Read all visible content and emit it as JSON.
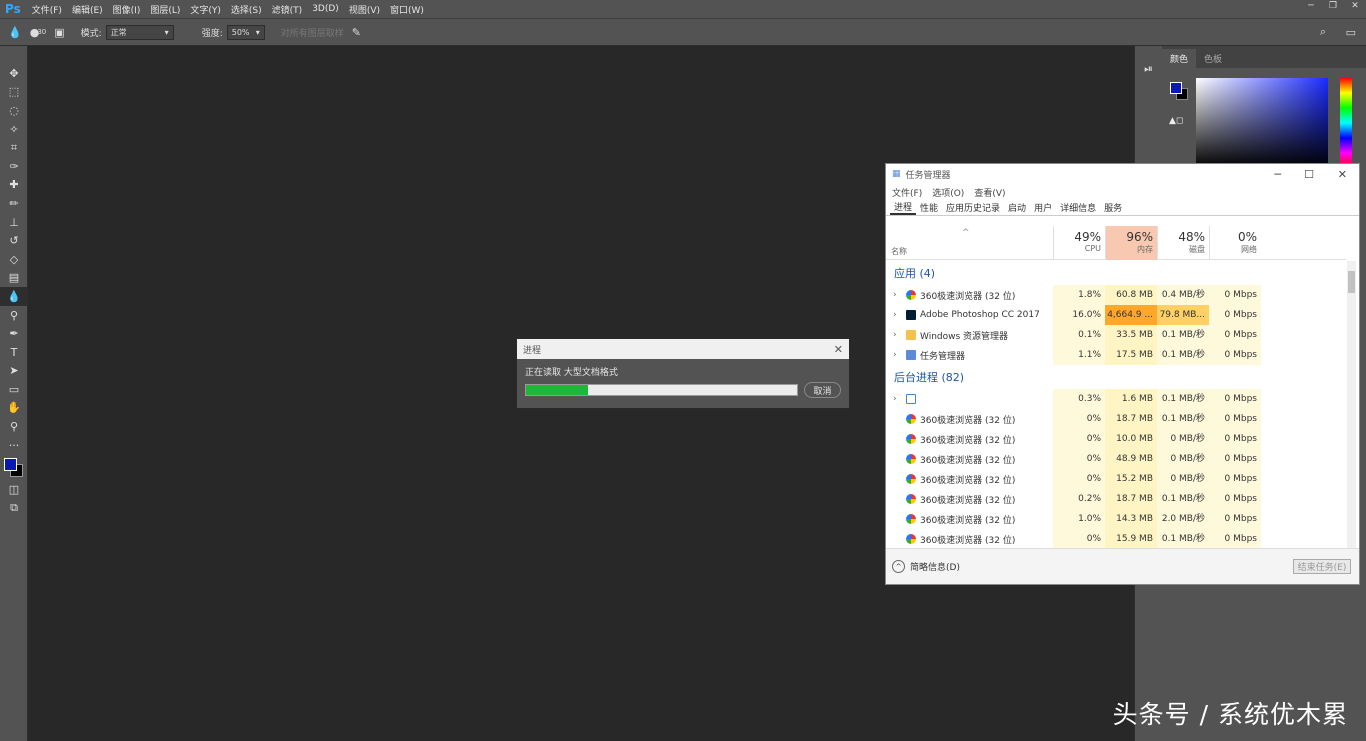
{
  "menubar": {
    "logo": "Ps",
    "items": [
      "文件(F)",
      "编辑(E)",
      "图像(I)",
      "图层(L)",
      "文字(Y)",
      "选择(S)",
      "滤镜(T)",
      "3D(D)",
      "视图(V)",
      "窗口(W)"
    ]
  },
  "options": {
    "brush_size": "30",
    "mode_label": "模式:",
    "mode_value": "正常",
    "strength_label": "强度:",
    "strength_value": "50%",
    "sample_all": "对所有图层取样"
  },
  "right_panel": {
    "tabs": [
      "颜色",
      "色板"
    ],
    "fg_color": "#0a19b4",
    "bg_color": "#000000"
  },
  "ps_dialog": {
    "title": "进程",
    "message": "正在读取 大型文档格式",
    "progress": 0.23,
    "cancel": "取消"
  },
  "task_manager": {
    "title": "任务管理器",
    "menu": [
      "文件(F)",
      "选项(O)",
      "查看(V)"
    ],
    "tabs": [
      "进程",
      "性能",
      "应用历史记录",
      "启动",
      "用户",
      "详细信息",
      "服务"
    ],
    "name_header": "名称",
    "columns": [
      {
        "pct": "49%",
        "label": "CPU"
      },
      {
        "pct": "96%",
        "label": "内存"
      },
      {
        "pct": "48%",
        "label": "磁盘"
      },
      {
        "pct": "0%",
        "label": "网络"
      }
    ],
    "apps_group": "应用 (4)",
    "apps": [
      {
        "name": "360极速浏览器 (32 位)",
        "cpu": "1.8%",
        "mem": "60.8 MB",
        "disk": "0.4 MB/秒",
        "net": "0 Mbps",
        "icon": "browser-icon"
      },
      {
        "name": "Adobe Photoshop CC 2017",
        "cpu": "16.0%",
        "mem": "4,664.9 ...",
        "disk": "79.8 MB...",
        "net": "0 Mbps",
        "icon": "photoshop-icon"
      },
      {
        "name": "Windows 资源管理器",
        "cpu": "0.1%",
        "mem": "33.5 MB",
        "disk": "0.1 MB/秒",
        "net": "0 Mbps",
        "icon": "folder-icon"
      },
      {
        "name": "任务管理器",
        "cpu": "1.1%",
        "mem": "17.5 MB",
        "disk": "0.1 MB/秒",
        "net": "0 Mbps",
        "icon": "taskmgr-icon"
      }
    ],
    "bg_group": "后台进程 (82)",
    "bg": [
      {
        "name": "",
        "cpu": "0.3%",
        "mem": "1.6 MB",
        "disk": "0.1 MB/秒",
        "net": "0 Mbps"
      },
      {
        "name": "360极速浏览器 (32 位)",
        "cpu": "0%",
        "mem": "18.7 MB",
        "disk": "0.1 MB/秒",
        "net": "0 Mbps"
      },
      {
        "name": "360极速浏览器 (32 位)",
        "cpu": "0%",
        "mem": "10.0 MB",
        "disk": "0 MB/秒",
        "net": "0 Mbps"
      },
      {
        "name": "360极速浏览器 (32 位)",
        "cpu": "0%",
        "mem": "48.9 MB",
        "disk": "0 MB/秒",
        "net": "0 Mbps"
      },
      {
        "name": "360极速浏览器 (32 位)",
        "cpu": "0%",
        "mem": "15.2 MB",
        "disk": "0 MB/秒",
        "net": "0 Mbps"
      },
      {
        "name": "360极速浏览器 (32 位)",
        "cpu": "0.2%",
        "mem": "18.7 MB",
        "disk": "0.1 MB/秒",
        "net": "0 Mbps"
      },
      {
        "name": "360极速浏览器 (32 位)",
        "cpu": "1.0%",
        "mem": "14.3 MB",
        "disk": "2.0 MB/秒",
        "net": "0 Mbps"
      },
      {
        "name": "360极速浏览器 (32 位)",
        "cpu": "0%",
        "mem": "15.9 MB",
        "disk": "0.1 MB/秒",
        "net": "0 Mbps"
      }
    ],
    "footer_less": "简略信息(D)",
    "end_task": "结束任务(E)"
  },
  "watermark": "头条号 / 系统优木累"
}
